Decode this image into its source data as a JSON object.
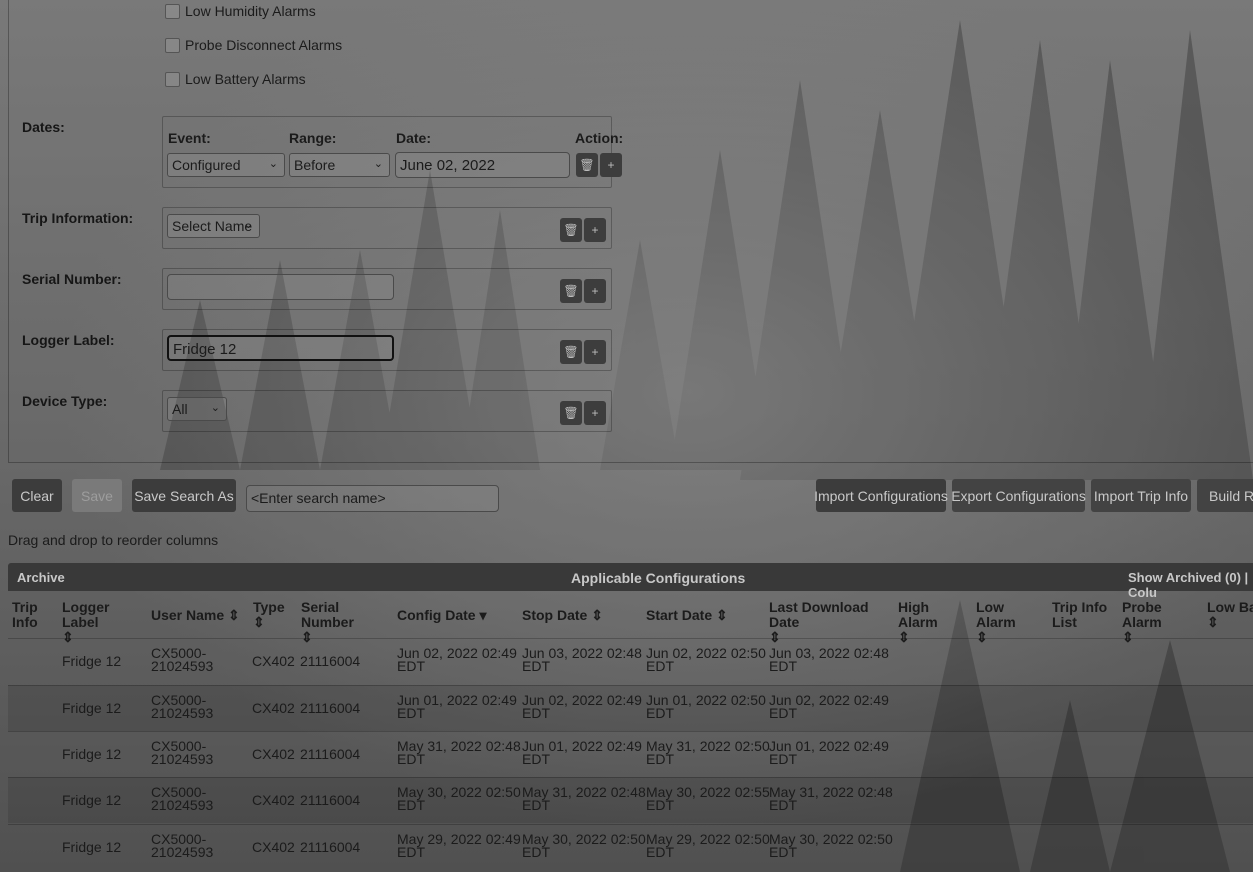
{
  "alarms": {
    "low_humidity": "Low Humidity Alarms",
    "probe_disconnect": "Probe Disconnect Alarms",
    "low_battery": "Low Battery Alarms"
  },
  "dates": {
    "label": "Dates:",
    "event_header": "Event:",
    "range_header": "Range:",
    "date_header": "Date:",
    "action_header": "Action:",
    "event_value": "Configured",
    "range_value": "Before",
    "date_value": "June 02, 2022"
  },
  "trip_info": {
    "label": "Trip Information:",
    "select_value": "Select Name"
  },
  "serial_number": {
    "label": "Serial Number:",
    "value": ""
  },
  "logger_label": {
    "label": "Logger Label:",
    "value": "Fridge 12"
  },
  "device_type": {
    "label": "Device Type:",
    "value": "All"
  },
  "icons": {
    "delete": "trash-icon",
    "add": "plus-icon",
    "dropdown": "chevron-down-icon",
    "sort": "sort-icon"
  },
  "toolbar": {
    "clear": "Clear",
    "save": "Save",
    "save_search_as": "Save Search As",
    "search_name_placeholder": "<Enter search name>",
    "import_configurations": "Import Configurations",
    "export_configurations": "Export Configurations",
    "import_trip_info": "Import Trip Info",
    "build_report": "Build Re"
  },
  "hint": "Drag and drop to reorder columns",
  "table": {
    "archive": "Archive",
    "title": "Applicable Configurations",
    "show_archived": "Show Archived (0) | Colu",
    "columns": {
      "trip_info": "Trip Info",
      "logger_label": "Logger Label",
      "user_name": "User Name ⇕",
      "type": "Type",
      "serial_number": "Serial Number",
      "config_date": "Config Date ▾",
      "stop_date": "Stop Date ⇕",
      "start_date": "Start Date ⇕",
      "last_download": "Last Download Date",
      "high_alarm": "High Alarm",
      "low_alarm": "Low Alarm",
      "trip_info_list": "Trip Info List",
      "probe_alarm": "Probe Alarm",
      "low_battery": "Low Bat"
    },
    "rows": [
      {
        "logger": "Fridge 12",
        "user1": "CX5000-",
        "user2": "21024593",
        "type": "CX402",
        "serial": "21116004",
        "config1": "Jun 02, 2022 02:49",
        "stop1": "Jun 03, 2022 02:48",
        "start1": "Jun 02, 2022 02:50",
        "last1": "Jun 03, 2022 02:48",
        "tz": "EDT"
      },
      {
        "logger": "Fridge 12",
        "user1": "CX5000-",
        "user2": "21024593",
        "type": "CX402",
        "serial": "21116004",
        "config1": "Jun 01, 2022 02:49",
        "stop1": "Jun 02, 2022 02:49",
        "start1": "Jun 01, 2022 02:50",
        "last1": "Jun 02, 2022 02:49",
        "tz": "EDT"
      },
      {
        "logger": "Fridge 12",
        "user1": "CX5000-",
        "user2": "21024593",
        "type": "CX402",
        "serial": "21116004",
        "config1": "May 31, 2022 02:48",
        "stop1": "Jun 01, 2022 02:49",
        "start1": "May 31, 2022 02:50",
        "last1": "Jun 01, 2022 02:49",
        "tz": "EDT"
      },
      {
        "logger": "Fridge 12",
        "user1": "CX5000-",
        "user2": "21024593",
        "type": "CX402",
        "serial": "21116004",
        "config1": "May 30, 2022 02:50",
        "stop1": "May 31, 2022 02:48",
        "start1": "May 30, 2022 02:55",
        "last1": "May 31, 2022 02:48",
        "tz": "EDT"
      },
      {
        "logger": "Fridge 12",
        "user1": "CX5000-",
        "user2": "21024593",
        "type": "CX402",
        "serial": "21116004",
        "config1": "May 29, 2022 02:49",
        "stop1": "May 30, 2022 02:50",
        "start1": "May 29, 2022 02:50",
        "last1": "May 30, 2022 02:50",
        "tz": "EDT"
      }
    ]
  }
}
